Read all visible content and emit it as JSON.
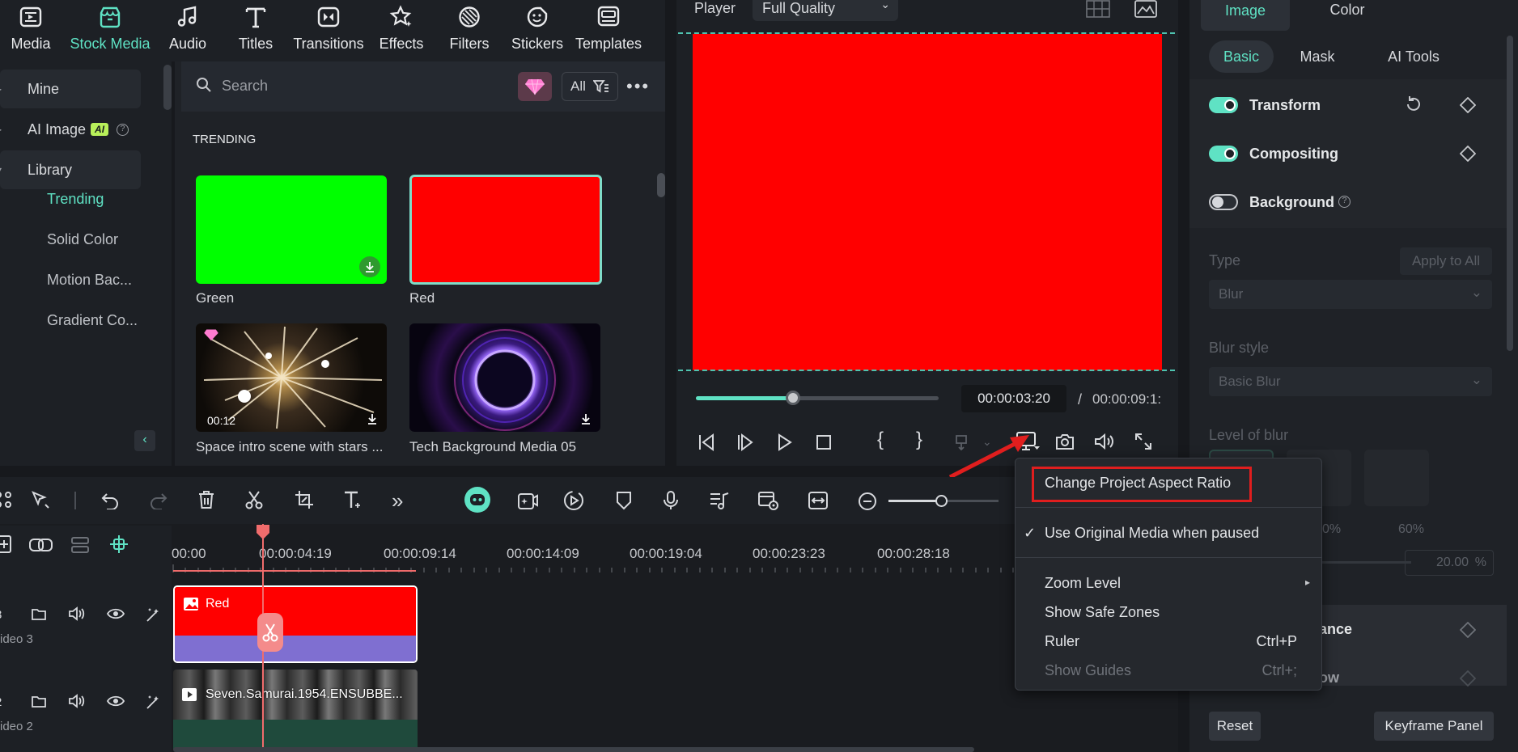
{
  "toolbar": {
    "items": [
      {
        "label": "Media",
        "icon": "media-icon"
      },
      {
        "label": "Stock Media",
        "icon": "stock-media-icon",
        "active": true
      },
      {
        "label": "Audio",
        "icon": "music-note-icon"
      },
      {
        "label": "Titles",
        "icon": "text-t-icon"
      },
      {
        "label": "Transitions",
        "icon": "transitions-icon"
      },
      {
        "label": "Effects",
        "icon": "sparkle-star-icon"
      },
      {
        "label": "Filters",
        "icon": "filters-icon"
      },
      {
        "label": "Stickers",
        "icon": "sticker-face-icon"
      },
      {
        "label": "Templates",
        "icon": "templates-icon"
      }
    ]
  },
  "leftnav": {
    "mine": "Mine",
    "ai_image": "AI Image",
    "ai_badge": "AI",
    "library": "Library",
    "subitems": [
      "Trending",
      "Solid Color",
      "Motion Bac...",
      "Gradient Co..."
    ]
  },
  "media": {
    "search_placeholder": "Search",
    "filter_label": "All",
    "section_title": "TRENDING",
    "items": [
      {
        "label": "Green",
        "color": "#00ff00"
      },
      {
        "label": "Red",
        "color": "#ff0000"
      },
      {
        "label": "Space intro scene with stars ...",
        "duration": "00:12"
      },
      {
        "label": "Tech Background Media 05"
      }
    ]
  },
  "player": {
    "label": "Player",
    "quality": "Full Quality",
    "preview_color": "#ff0000",
    "current_time": "00:00:03:20",
    "separator": "/",
    "total_time": "00:00:09:1:",
    "progress": 0.4
  },
  "right": {
    "tabs": [
      "Image",
      "Color"
    ],
    "subtabs": [
      "Basic",
      "Mask",
      "AI Tools"
    ],
    "transform": "Transform",
    "compositing": "Compositing",
    "background": "Background",
    "type_label": "Type",
    "apply_all": "Apply to All",
    "type_value": "Blur",
    "blur_style_label": "Blur style",
    "blur_style_value": "Basic Blur",
    "level_label": "Level of blur",
    "pct_0": "0%",
    "pct_60": "60%",
    "blur_value": "20.00",
    "blur_unit": "%",
    "ance_partial": "ance",
    "ow_partial": "ow",
    "reset": "Reset",
    "keyframe_panel": "Keyframe Panel"
  },
  "timeline": {
    "ruler": [
      "00:00",
      "00:00:04:19",
      "00:00:09:14",
      "00:00:14:09",
      "00:00:19:04",
      "00:00:23:23",
      "00:00:28:18"
    ],
    "tracks": [
      {
        "num": "3",
        "name": "ideo 3",
        "clip": "Red"
      },
      {
        "num": "2",
        "name": "ideo 2",
        "clip": "Seven.Samurai.1954.ENSUBBE..."
      }
    ]
  },
  "menu": {
    "items": [
      {
        "label": "Change Project Aspect Ratio"
      },
      {
        "label": "Use Original Media when paused",
        "checked": true
      },
      {
        "label": "Zoom Level",
        "submenu": true
      },
      {
        "label": "Show Safe Zones"
      },
      {
        "label": "Ruler",
        "shortcut": "Ctrl+P"
      },
      {
        "label": "Show Guides",
        "shortcut": "Ctrl+;",
        "disabled": true
      }
    ]
  },
  "colors": {
    "accent": "#5fe2c4",
    "highlight": "#e01e1e",
    "clip_purple": "#7f6fd1"
  }
}
